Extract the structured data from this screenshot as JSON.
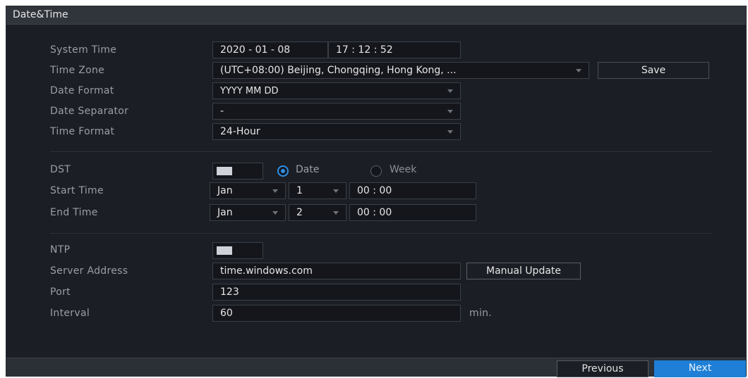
{
  "window": {
    "title": "Date&Time"
  },
  "form": {
    "system_time": {
      "label": "System Time",
      "date": "2020  - 01 - 08",
      "time": "17 : 12 : 52"
    },
    "time_zone": {
      "label": "Time Zone",
      "value": "(UTC+08:00) Beijing, Chongqing, Hong Kong, ...",
      "save_label": "Save"
    },
    "date_format": {
      "label": "Date Format",
      "value": "YYYY MM DD"
    },
    "date_separator": {
      "label": "Date Separator",
      "value": "-"
    },
    "time_format": {
      "label": "Time Format",
      "value": "24-Hour"
    },
    "dst": {
      "label": "DST",
      "enabled": false,
      "option_date": "Date",
      "option_week": "Week",
      "selected": "Date"
    },
    "start_time": {
      "label": "Start Time",
      "month": "Jan",
      "day": "1",
      "time": "00 : 00"
    },
    "end_time": {
      "label": "End Time",
      "month": "Jan",
      "day": "2",
      "time": "00 : 00"
    },
    "ntp": {
      "label": "NTP",
      "enabled": false
    },
    "server_address": {
      "label": "Server Address",
      "value": "time.windows.com",
      "manual_update_label": "Manual Update"
    },
    "port": {
      "label": "Port",
      "value": "123"
    },
    "interval": {
      "label": "Interval",
      "value": "60",
      "unit": "min."
    }
  },
  "footer": {
    "previous_label": "Previous",
    "next_label": "Next"
  },
  "colors": {
    "panel_bg": "#1b1e24",
    "accent": "#2e8fe6",
    "label": "#9a9ea6",
    "text": "#e6e6e6"
  },
  "icons": {
    "dropdown": "chevron-down-icon",
    "toggle_knob": "toggle-knob-icon"
  }
}
